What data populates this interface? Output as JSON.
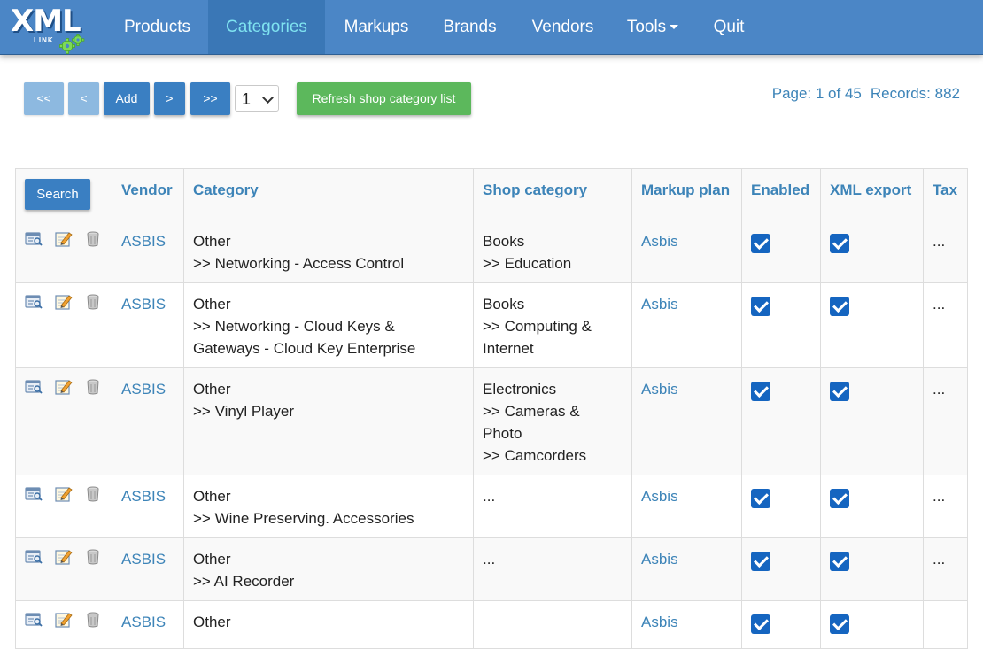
{
  "nav": {
    "logo_text": "XML",
    "logo_sub": "LINK",
    "items": [
      {
        "label": "Products",
        "active": false
      },
      {
        "label": "Categories",
        "active": true
      },
      {
        "label": "Markups",
        "active": false
      },
      {
        "label": "Brands",
        "active": false
      },
      {
        "label": "Vendors",
        "active": false
      },
      {
        "label": "Tools",
        "active": false,
        "dropdown": true
      },
      {
        "label": "Quit",
        "active": false
      }
    ]
  },
  "toolbar": {
    "first_label": "<<",
    "prev_label": "<",
    "add_label": "Add",
    "next_label": ">",
    "last_label": ">>",
    "page_selected": "1",
    "refresh_label": "Refresh shop category list"
  },
  "pageinfo": {
    "page_text": "Page: 1 of 45",
    "records_text": "Records: 882"
  },
  "table": {
    "search_label": "Search",
    "columns": [
      "Vendor",
      "Category",
      "Shop category",
      "Markup plan",
      "Enabled",
      "XML export",
      "Tax"
    ],
    "rows": [
      {
        "vendor": "ASBIS",
        "category": [
          "Other",
          ">> Networking - Access Control"
        ],
        "shop_category": [
          "Books",
          ">> Education"
        ],
        "markup_plan": "Asbis",
        "enabled": true,
        "xml_export": true,
        "tax": "..."
      },
      {
        "vendor": "ASBIS",
        "category": [
          "Other",
          ">> Networking - Cloud Keys &",
          "Gateways - Cloud Key Enterprise"
        ],
        "shop_category": [
          "Books",
          ">> Computing &",
          "Internet"
        ],
        "markup_plan": "Asbis",
        "enabled": true,
        "xml_export": true,
        "tax": "..."
      },
      {
        "vendor": "ASBIS",
        "category": [
          "Other",
          ">> Vinyl Player"
        ],
        "shop_category": [
          "Electronics",
          ">> Cameras &",
          "Photo",
          ">> Camcorders"
        ],
        "markup_plan": "Asbis",
        "enabled": true,
        "xml_export": true,
        "tax": "..."
      },
      {
        "vendor": "ASBIS",
        "category": [
          "Other",
          ">> Wine Preserving. Accessories"
        ],
        "shop_category": [
          "..."
        ],
        "markup_plan": "Asbis",
        "enabled": true,
        "xml_export": true,
        "tax": "..."
      },
      {
        "vendor": "ASBIS",
        "category": [
          "Other",
          ">> AI Recorder"
        ],
        "shop_category": [
          "..."
        ],
        "markup_plan": "Asbis",
        "enabled": true,
        "xml_export": true,
        "tax": "..."
      },
      {
        "vendor": "ASBIS",
        "category": [
          "Other"
        ],
        "shop_category": [
          ""
        ],
        "markup_plan": "Asbis",
        "enabled": true,
        "xml_export": true,
        "tax": ""
      }
    ]
  },
  "colors": {
    "navbar": "#4b86c6",
    "nav_active_bg": "#3a77b6",
    "nav_active_text": "#7fe3f0",
    "primary_button": "#3a7fc2",
    "success_button": "#5cb85c",
    "link": "#3d84b8",
    "checkbox": "#1565c0"
  }
}
